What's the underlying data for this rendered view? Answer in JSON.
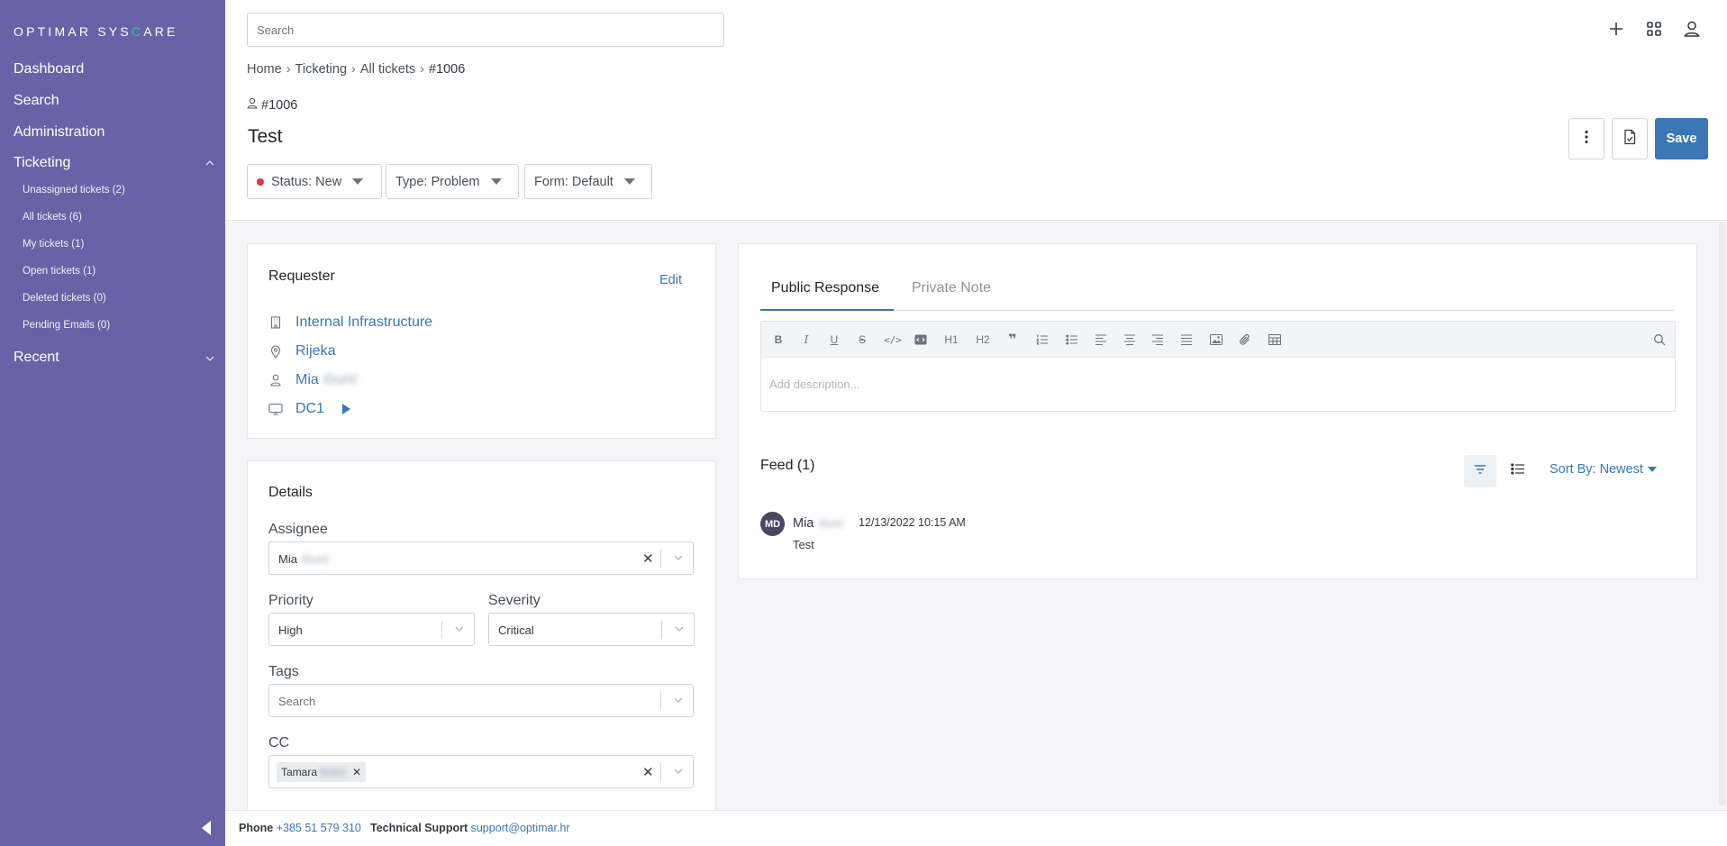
{
  "brand": {
    "logo_prefix": "OPTIMAR SYS",
    "logo_accent": "C",
    "logo_suffix": "ARE"
  },
  "sidebar": {
    "items": [
      {
        "label": "Dashboard"
      },
      {
        "label": "Search"
      },
      {
        "label": "Administration"
      },
      {
        "label": "Ticketing"
      },
      {
        "label": "Recent"
      }
    ],
    "ticketing_sub": [
      {
        "label": "Unassigned tickets (2)"
      },
      {
        "label": "All tickets (6)"
      },
      {
        "label": "My tickets (1)"
      },
      {
        "label": "Open tickets (1)"
      },
      {
        "label": "Deleted tickets (0)"
      },
      {
        "label": "Pending Emails (0)"
      }
    ]
  },
  "header": {
    "search_placeholder": "Search",
    "breadcrumb": [
      "Home",
      "Ticketing",
      "All tickets",
      "#1006"
    ],
    "ticket_id": "#1006",
    "title": "Test",
    "status": "Status: New",
    "type": "Type: Problem",
    "form": "Form: Default",
    "save_label": "Save"
  },
  "requester": {
    "title": "Requester",
    "edit_label": "Edit",
    "organization": "Internal Infrastructure",
    "location": "Rijeka",
    "person_first": "Mia",
    "person_last": "Đurić",
    "device": "DC1"
  },
  "details": {
    "title": "Details",
    "assignee_label": "Assignee",
    "assignee_first": "Mia",
    "assignee_last": "Đurić",
    "priority_label": "Priority",
    "priority_value": "High",
    "severity_label": "Severity",
    "severity_value": "Critical",
    "tags_label": "Tags",
    "tags_placeholder": "Search",
    "cc_label": "CC",
    "cc_first": "Tamara",
    "cc_last": "Babić"
  },
  "editor": {
    "tab_public": "Public Response",
    "tab_private": "Private Note",
    "placeholder": "Add description...",
    "toolbar": [
      "B",
      "I",
      "U",
      "S",
      "</>",
      "code-block",
      "H1",
      "H2",
      "quote",
      "ordered-list",
      "bullet-list",
      "align-left",
      "align-center",
      "align-right",
      "align-justify",
      "image",
      "attachment",
      "table",
      "search"
    ]
  },
  "feed": {
    "title": "Feed (1)",
    "sort_label": "Sort By: Newest",
    "entries": [
      {
        "initials": "MD",
        "author_first": "Mia",
        "author_last": "Đurić",
        "time": "12/13/2022 10:15 AM",
        "text": "Test"
      }
    ]
  },
  "footer": {
    "phone_label": "Phone",
    "phone_value": "+385 51 579 310",
    "support_label": "Technical Support",
    "support_value": "support@optimar.hr"
  },
  "colors": {
    "sidebar": "#6a62a7",
    "accent": "#3a77b4",
    "status_new": "#dc3545",
    "logo_accent": "#2ec4a6"
  }
}
